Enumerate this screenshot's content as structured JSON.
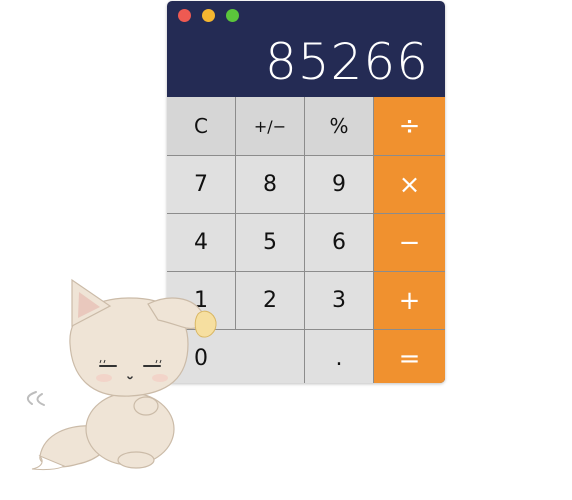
{
  "display": {
    "value": "85266"
  },
  "window": {
    "buttons": [
      {
        "name": "close",
        "color": "#ee5a52"
      },
      {
        "name": "minimize",
        "color": "#f5b630"
      },
      {
        "name": "maximize",
        "color": "#5bc53b"
      }
    ]
  },
  "keys": {
    "clear": "C",
    "sign": "+/−",
    "percent": "%",
    "divide": "÷",
    "seven": "7",
    "eight": "8",
    "nine": "9",
    "multiply": "×",
    "four": "4",
    "five": "5",
    "six": "6",
    "subtract": "−",
    "one": "1",
    "two": "2",
    "three": "3",
    "add": "+",
    "zero": "0",
    "decimal": ".",
    "equals": "="
  },
  "colors": {
    "display_bg": "#242b54",
    "operator": "#f0912f",
    "key": "#e0e0e0"
  }
}
